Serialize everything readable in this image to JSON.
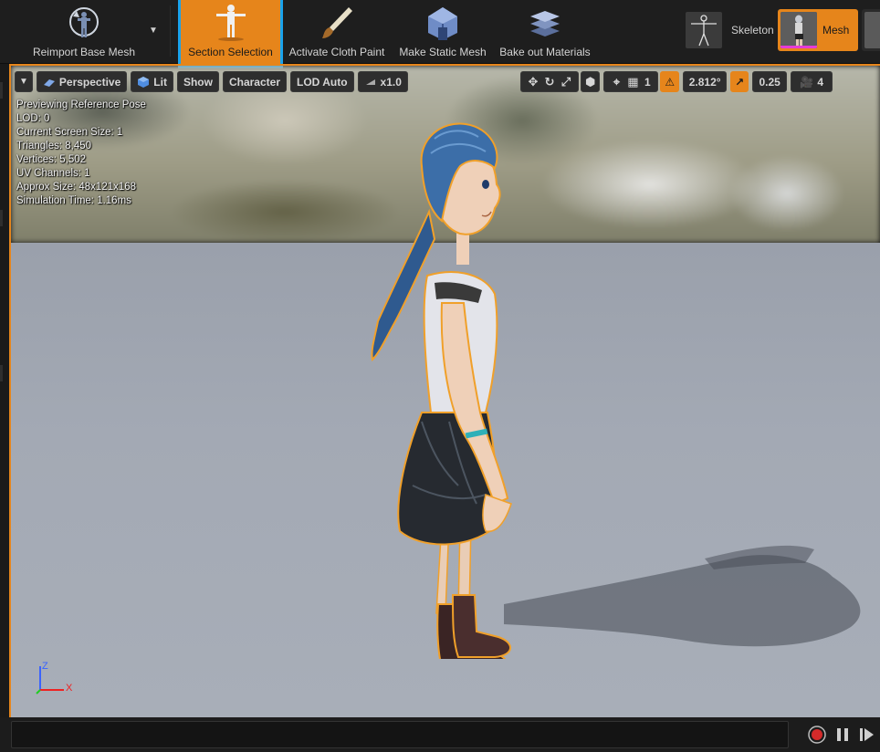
{
  "toolbar": {
    "reimport_label": "Reimport Base Mesh",
    "section_selection_label": "Section Selection",
    "cloth_paint_label": "Activate Cloth Paint",
    "static_mesh_label": "Make Static Mesh",
    "bake_materials_label": "Bake out Materials"
  },
  "modes": {
    "skeleton_label": "Skeleton",
    "mesh_label": "Mesh"
  },
  "viewport": {
    "perspective_label": "Perspective",
    "lit_label": "Lit",
    "show_label": "Show",
    "character_label": "Character",
    "lod_label": "LOD Auto",
    "play_speed_label": "x1.0",
    "grid_snap_value": "1",
    "rotation_snap_value": "2.812°",
    "scale_snap_value": "0.25",
    "camera_speed_value": "4",
    "axis_z": "Z",
    "axis_x": "X"
  },
  "stats": {
    "line1": "Previewing Reference Pose",
    "line2": "LOD: 0",
    "line3": "Current Screen Size: 1",
    "line4": "Triangles: 8,450",
    "line5": "Vertices: 5,502",
    "line6": "UV Channels: 1",
    "line7": "Approx Size: 48x121x168",
    "line8": "Simulation Time: 1.16ms"
  },
  "colors": {
    "accent_orange": "#e6851b",
    "selection_blue": "#1aa3ec",
    "record_red": "#d42a2a"
  },
  "statusbar": {
    "console_value": ""
  }
}
